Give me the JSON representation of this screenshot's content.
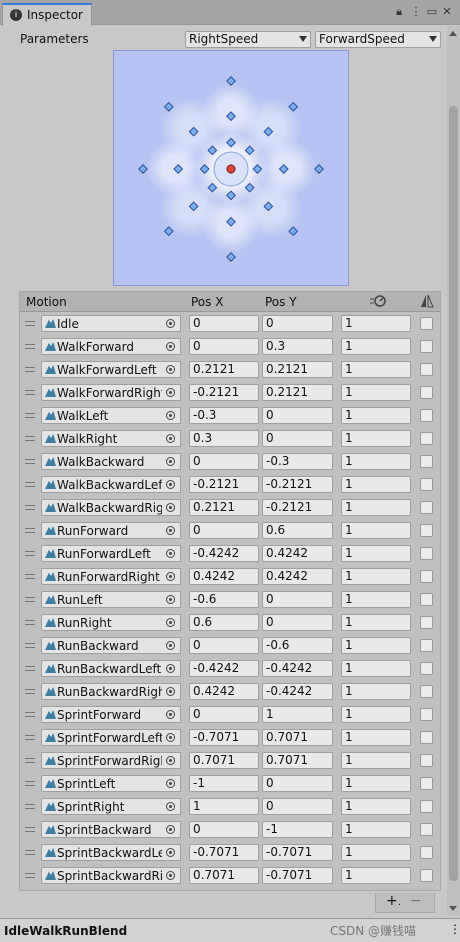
{
  "window": {
    "tab_label": "Inspector",
    "tab_icon": "info-icon",
    "controls": [
      "lock-icon",
      "menu-icon"
    ]
  },
  "parameters": {
    "label": "Parameters",
    "x_param": "RightSpeed",
    "y_param": "ForwardSpeed"
  },
  "blend_space": {
    "points": [
      [
        0,
        0
      ],
      [
        0,
        0.3
      ],
      [
        -0.2121,
        0.2121
      ],
      [
        0.2121,
        0.2121
      ],
      [
        -0.3,
        0
      ],
      [
        0.3,
        0
      ],
      [
        0,
        -0.3
      ],
      [
        -0.2121,
        -0.2121
      ],
      [
        0.2121,
        -0.2121
      ],
      [
        0,
        0.6
      ],
      [
        -0.4242,
        0.4242
      ],
      [
        0.4242,
        0.4242
      ],
      [
        -0.6,
        0
      ],
      [
        0.6,
        0
      ],
      [
        0,
        -0.6
      ],
      [
        -0.4242,
        -0.4242
      ],
      [
        0.4242,
        -0.4242
      ],
      [
        0,
        1
      ],
      [
        -0.7071,
        0.7071
      ],
      [
        0.7071,
        0.7071
      ],
      [
        -1,
        0
      ],
      [
        1,
        0
      ],
      [
        0,
        -1
      ],
      [
        -0.7071,
        -0.7071
      ],
      [
        0.7071,
        -0.7071
      ]
    ],
    "current": [
      0,
      0
    ],
    "point_color": "#7aaef0",
    "current_color": "#e0443a"
  },
  "table": {
    "headers": {
      "motion": "Motion",
      "pos_x": "Pos X",
      "pos_y": "Pos Y"
    },
    "header_icons": [
      "speed-icon",
      "mirror-icon"
    ],
    "rows": [
      {
        "motion": "Idle",
        "x": "0",
        "y": "0",
        "speed": "1"
      },
      {
        "motion": "WalkForward",
        "x": "0",
        "y": "0.3",
        "speed": "1"
      },
      {
        "motion": "WalkForwardLeft",
        "x": "0.2121",
        "y": "0.2121",
        "speed": "1"
      },
      {
        "motion": "WalkForwardRight",
        "x": "-0.2121",
        "y": "0.2121",
        "speed": "1"
      },
      {
        "motion": "WalkLeft",
        "x": "-0.3",
        "y": "0",
        "speed": "1"
      },
      {
        "motion": "WalkRight",
        "x": "0.3",
        "y": "0",
        "speed": "1"
      },
      {
        "motion": "WalkBackward",
        "x": "0",
        "y": "-0.3",
        "speed": "1"
      },
      {
        "motion": "WalkBackwardLeft",
        "x": "-0.2121",
        "y": "-0.2121",
        "speed": "1"
      },
      {
        "motion": "WalkBackwardRight",
        "x": "0.2121",
        "y": "-0.2121",
        "speed": "1"
      },
      {
        "motion": "RunForward",
        "x": "0",
        "y": "0.6",
        "speed": "1"
      },
      {
        "motion": "RunForwardLeft",
        "x": "-0.4242",
        "y": "0.4242",
        "speed": "1"
      },
      {
        "motion": "RunForwardRight",
        "x": "0.4242",
        "y": "0.4242",
        "speed": "1"
      },
      {
        "motion": "RunLeft",
        "x": "-0.6",
        "y": "0",
        "speed": "1"
      },
      {
        "motion": "RunRight",
        "x": "0.6",
        "y": "0",
        "speed": "1"
      },
      {
        "motion": "RunBackward",
        "x": "0",
        "y": "-0.6",
        "speed": "1"
      },
      {
        "motion": "RunBackwardLeft",
        "x": "-0.4242",
        "y": "-0.4242",
        "speed": "1"
      },
      {
        "motion": "RunBackwardRight",
        "x": "0.4242",
        "y": "-0.4242",
        "speed": "1"
      },
      {
        "motion": "SprintForward",
        "x": "0",
        "y": "1",
        "speed": "1"
      },
      {
        "motion": "SprintForwardLeft",
        "x": "-0.7071",
        "y": "0.7071",
        "speed": "1"
      },
      {
        "motion": "SprintForwardRight",
        "x": "0.7071",
        "y": "0.7071",
        "speed": "1"
      },
      {
        "motion": "SprintLeft",
        "x": "-1",
        "y": "0",
        "speed": "1"
      },
      {
        "motion": "SprintRight",
        "x": "1",
        "y": "0",
        "speed": "1"
      },
      {
        "motion": "SprintBackward",
        "x": "0",
        "y": "-1",
        "speed": "1"
      },
      {
        "motion": "SprintBackwardLeft",
        "x": "-0.7071",
        "y": "-0.7071",
        "speed": "1"
      },
      {
        "motion": "SprintBackwardRight",
        "x": "0.7071",
        "y": "-0.7071",
        "speed": "1"
      }
    ]
  },
  "footer": {
    "add": "+",
    "remove": "−",
    "add_extra": "."
  },
  "asset_name": "IdleWalkRunBlend",
  "watermark": "CSDN @赚钱喵",
  "more_icon": "⋮"
}
